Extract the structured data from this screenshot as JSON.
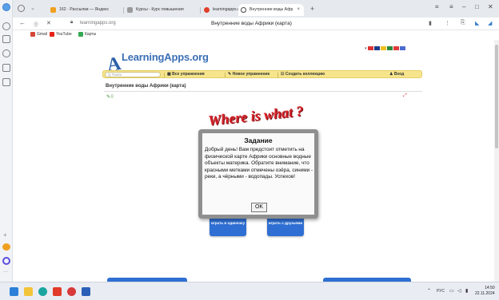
{
  "browser": {
    "tabs": [
      {
        "label": "162 · Рассылки — Яндекс",
        "fav_color": "#f0a020"
      },
      {
        "label": "Курсы - Курс повышения",
        "fav_color": "#9a9a9a"
      },
      {
        "label": "learningapps.org на русс",
        "fav_color": "#e0402a"
      },
      {
        "label": "Внутренние воды Афр",
        "fav_color": "#444444",
        "active": true
      }
    ],
    "new_tab": "+",
    "url": "learningapps.org",
    "page_title": "Внутренние воды Африки (карта)",
    "bookmarks": [
      {
        "label": "Gmail",
        "color": "#d44638"
      },
      {
        "label": "YouTube",
        "color": "#e62117"
      },
      {
        "label": "Карты",
        "color": "#34a853"
      }
    ]
  },
  "site": {
    "logo_letter": "A",
    "logo": "LearningApps.org",
    "search_placeholder": "Q Поиск",
    "menu": {
      "all": "Все упражнения",
      "new": "Новое упражнение",
      "collection": "Создать коллекцию",
      "login": "Вход"
    },
    "exercise_title": "Внутренние воды Африки (карта)",
    "banner": "Where is what ?",
    "buttons": {
      "single": "играть в одиночку",
      "friends": "играть с друзьями"
    }
  },
  "dialog": {
    "title": "Задание",
    "body": "Добрый день! Вам предстоит отметить на физической карте Африки основные водные объекты материка. Обратите внимание, что красными метками отмечены озёра, синими - реки, а чёрными - водопады. Успехов!",
    "ok": "OK"
  },
  "taskbar": {
    "lang": "РУС",
    "time": "14:50",
    "date": "22.11.2024"
  }
}
